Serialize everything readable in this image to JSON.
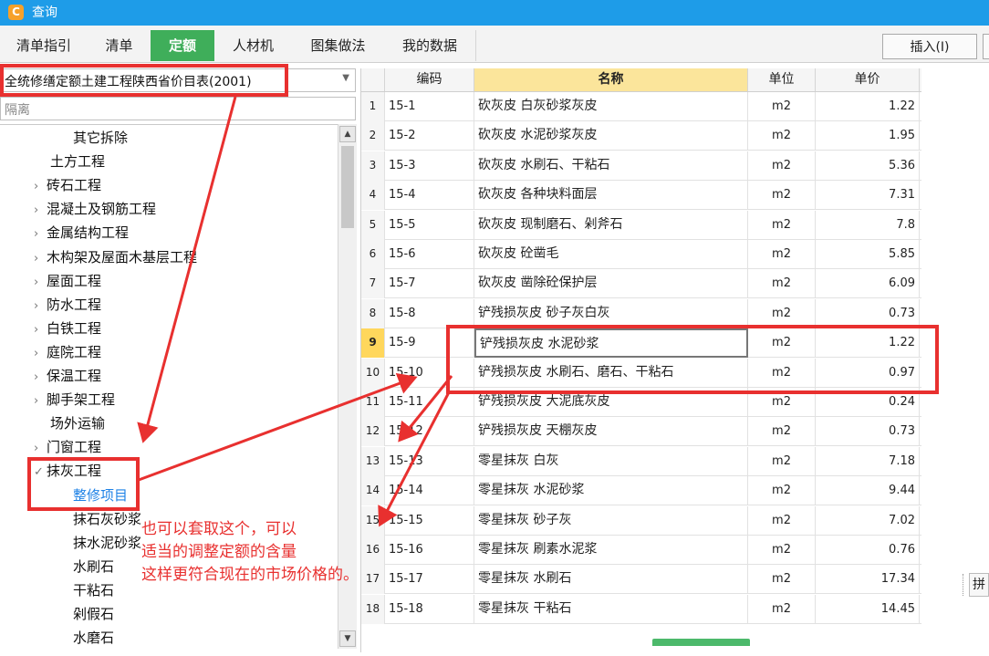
{
  "window": {
    "title": "查询",
    "logo_glyph": "C"
  },
  "tabs": [
    {
      "label": "清单指引",
      "active": false
    },
    {
      "label": "清单",
      "active": false
    },
    {
      "label": "定额",
      "active": true
    },
    {
      "label": "人材机",
      "active": false
    },
    {
      "label": "图集做法",
      "active": false
    },
    {
      "label": "我的数据",
      "active": false
    }
  ],
  "toolbar": {
    "insert_label": "插入(I)"
  },
  "catalog": {
    "selected": "全统修缮定额土建工程陕西省价目表(2001)"
  },
  "search": {
    "value": "隔离"
  },
  "tree": [
    {
      "label": "其它拆除",
      "has_children": false,
      "expanded": false,
      "selected": false
    },
    {
      "label": "土方工程",
      "has_children": false,
      "expanded": false,
      "selected": false
    },
    {
      "label": "砖石工程",
      "has_children": true,
      "expanded": false,
      "selected": false
    },
    {
      "label": "混凝土及钢筋工程",
      "has_children": true,
      "expanded": false,
      "selected": false
    },
    {
      "label": "金属结构工程",
      "has_children": true,
      "expanded": false,
      "selected": false
    },
    {
      "label": "木构架及屋面木基层工程",
      "has_children": true,
      "expanded": false,
      "selected": false
    },
    {
      "label": "屋面工程",
      "has_children": true,
      "expanded": false,
      "selected": false
    },
    {
      "label": "防水工程",
      "has_children": true,
      "expanded": false,
      "selected": false
    },
    {
      "label": "白铁工程",
      "has_children": true,
      "expanded": false,
      "selected": false
    },
    {
      "label": "庭院工程",
      "has_children": true,
      "expanded": false,
      "selected": false
    },
    {
      "label": "保温工程",
      "has_children": true,
      "expanded": false,
      "selected": false
    },
    {
      "label": "脚手架工程",
      "has_children": true,
      "expanded": false,
      "selected": false
    },
    {
      "label": "场外运输",
      "has_children": false,
      "expanded": false,
      "selected": false
    },
    {
      "label": "门窗工程",
      "has_children": true,
      "expanded": false,
      "selected": false
    },
    {
      "label": "抹灰工程",
      "has_children": true,
      "expanded": true,
      "selected": false
    },
    {
      "label": "整修项目",
      "has_children": false,
      "expanded": false,
      "selected": true
    },
    {
      "label": "抹石灰砂浆",
      "has_children": false,
      "expanded": false,
      "selected": false
    },
    {
      "label": "抹水泥砂浆",
      "has_children": false,
      "expanded": false,
      "selected": false
    },
    {
      "label": "水刷石",
      "has_children": false,
      "expanded": false,
      "selected": false
    },
    {
      "label": "干粘石",
      "has_children": false,
      "expanded": false,
      "selected": false
    },
    {
      "label": "剁假石",
      "has_children": false,
      "expanded": false,
      "selected": false
    },
    {
      "label": "水磨石",
      "has_children": false,
      "expanded": false,
      "selected": false
    }
  ],
  "table": {
    "headers": {
      "code": "编码",
      "name": "名称",
      "unit": "单位",
      "price": "单价"
    },
    "rows": [
      {
        "n": "1",
        "code": "15-1",
        "name": "砍灰皮 白灰砂浆灰皮",
        "unit": "m2",
        "price": "1.22"
      },
      {
        "n": "2",
        "code": "15-2",
        "name": "砍灰皮 水泥砂浆灰皮",
        "unit": "m2",
        "price": "1.95"
      },
      {
        "n": "3",
        "code": "15-3",
        "name": "砍灰皮 水刷石、干粘石",
        "unit": "m2",
        "price": "5.36"
      },
      {
        "n": "4",
        "code": "15-4",
        "name": "砍灰皮 各种块料面层",
        "unit": "m2",
        "price": "7.31"
      },
      {
        "n": "5",
        "code": "15-5",
        "name": "砍灰皮 现制磨石、剁斧石",
        "unit": "m2",
        "price": "7.8"
      },
      {
        "n": "6",
        "code": "15-6",
        "name": "砍灰皮 砼凿毛",
        "unit": "m2",
        "price": "5.85"
      },
      {
        "n": "7",
        "code": "15-7",
        "name": "砍灰皮 凿除砼保护层",
        "unit": "m2",
        "price": "6.09"
      },
      {
        "n": "8",
        "code": "15-8",
        "name": "铲残损灰皮 砂子灰白灰",
        "unit": "m2",
        "price": "0.73"
      },
      {
        "n": "9",
        "code": "15-9",
        "name": "铲残损灰皮 水泥砂浆",
        "unit": "m2",
        "price": "1.22",
        "selected": true
      },
      {
        "n": "10",
        "code": "15-10",
        "name": "铲残损灰皮 水刷石、磨石、干粘石",
        "unit": "m2",
        "price": "0.97"
      },
      {
        "n": "11",
        "code": "15-11",
        "name": "铲残损灰皮 大泥底灰皮",
        "unit": "m2",
        "price": "0.24"
      },
      {
        "n": "12",
        "code": "15-12",
        "name": "铲残损灰皮 天棚灰皮",
        "unit": "m2",
        "price": "0.73"
      },
      {
        "n": "13",
        "code": "15-13",
        "name": "零星抹灰 白灰",
        "unit": "m2",
        "price": "7.18"
      },
      {
        "n": "14",
        "code": "15-14",
        "name": "零星抹灰 水泥砂浆",
        "unit": "m2",
        "price": "9.44"
      },
      {
        "n": "15",
        "code": "15-15",
        "name": "零星抹灰 砂子灰",
        "unit": "m2",
        "price": "7.02"
      },
      {
        "n": "16",
        "code": "15-16",
        "name": "零星抹灰 刷素水泥浆",
        "unit": "m2",
        "price": "0.76"
      },
      {
        "n": "17",
        "code": "15-17",
        "name": "零星抹灰 水刷石",
        "unit": "m2",
        "price": "17.34"
      },
      {
        "n": "18",
        "code": "15-18",
        "name": "零星抹灰 干粘石",
        "unit": "m2",
        "price": "14.45"
      }
    ]
  },
  "side_button": {
    "label": "拼"
  },
  "annotation": {
    "lines": [
      "也可以套取这个，可以",
      "适当的调整定额的含量",
      "这样更符合现在的市场价格的。"
    ],
    "color": "#e8302f"
  },
  "colors": {
    "title_bar": "#1e9ce8",
    "active_tab": "#3fae5a",
    "header_highlight": "#fbe59b",
    "row_selected": "#ffd75c",
    "annotation": "#e8302f"
  }
}
